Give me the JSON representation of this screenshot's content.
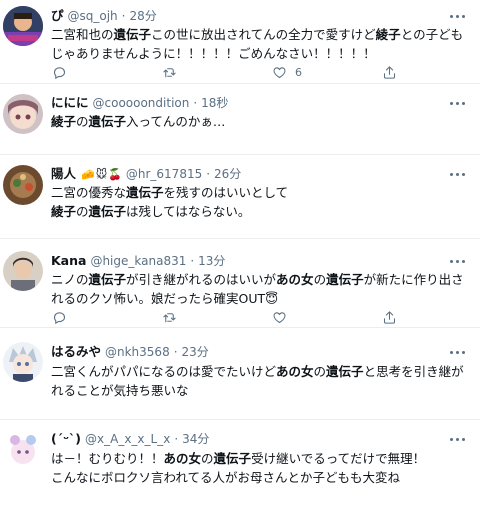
{
  "tweets": [
    {
      "name": "ぴ",
      "handle": "@sq_ojh",
      "time": "28分",
      "lines": [
        [
          {
            "t": "二宮和也の"
          },
          {
            "t": "遺伝子",
            "b": true
          },
          {
            "t": "この世に放出されてんの全力で愛すけど"
          },
          {
            "t": "綾子",
            "b": true
          },
          {
            "t": "との子ども"
          }
        ],
        [
          {
            "t": "じゃありませんように！！！！！ごめんなさい！！！！！"
          }
        ]
      ],
      "likes": "6"
    },
    {
      "name": "ににに",
      "handle": "@cooooondition",
      "time": "18秒",
      "lines": [
        [
          {
            "t": "綾子",
            "b": true
          },
          {
            "t": "の"
          },
          {
            "t": "遺伝子",
            "b": true
          },
          {
            "t": "入ってんのかぁ…"
          }
        ]
      ],
      "likes": ""
    },
    {
      "name": "陽人",
      "handle": "@hr_617815",
      "time": "26分",
      "lines": [
        [
          {
            "t": "二宮の優秀な"
          },
          {
            "t": "遺伝子",
            "b": true
          },
          {
            "t": "を残すのはいいとして"
          }
        ],
        [
          {
            "t": "綾子",
            "b": true
          },
          {
            "t": "の"
          },
          {
            "t": "遺伝子",
            "b": true
          },
          {
            "t": "は残してはならない。"
          }
        ]
      ],
      "likes": ""
    },
    {
      "name": "Kana",
      "handle": "@hige_kana831",
      "time": "13分",
      "lines": [
        [
          {
            "t": "ニノの"
          },
          {
            "t": "遺伝子",
            "b": true
          },
          {
            "t": "が引き継がれるのはいいが"
          },
          {
            "t": "あの女",
            "b": true
          },
          {
            "t": "の"
          },
          {
            "t": "遺伝子",
            "b": true
          },
          {
            "t": "が新たに作り出さ"
          }
        ],
        [
          {
            "t": "れるのクソ怖い。娘だったら確実OUT😇"
          }
        ]
      ],
      "likes": ""
    },
    {
      "name": "はるみや",
      "handle": "@nkh3568",
      "time": "23分",
      "lines": [
        [
          {
            "t": "二宮くんがパパになるのは愛でたいけど"
          },
          {
            "t": "あの女",
            "b": true
          },
          {
            "t": "の"
          },
          {
            "t": "遺伝子",
            "b": true
          },
          {
            "t": "と思考を引き継が"
          }
        ],
        [
          {
            "t": "れることが気持ち悪いな"
          }
        ]
      ],
      "likes": ""
    },
    {
      "name": "(´ᵕ`)",
      "handle": "@x_A_x_x_L_x",
      "time": "34分",
      "lines": [
        [
          {
            "t": "は－！むりむり！！"
          },
          {
            "t": "あの女",
            "b": true
          },
          {
            "t": "の"
          },
          {
            "t": "遺伝子",
            "b": true
          },
          {
            "t": "受け継いでるってだけで無理！"
          }
        ],
        [
          {
            "t": "こんなにボロクソ言われてる人がお母さんとか子どもも大変ね"
          }
        ]
      ],
      "likes": ""
    }
  ],
  "name_badges": [
    "🧀",
    "🐭",
    "🍒"
  ],
  "icons": {
    "reply": "reply-icon",
    "retweet": "retweet-icon",
    "like": "like-icon",
    "share": "share-icon",
    "more": "more-icon"
  },
  "colors": {
    "text": "#0f1419",
    "secondary": "#5b7083",
    "divider": "#ebeef0"
  }
}
